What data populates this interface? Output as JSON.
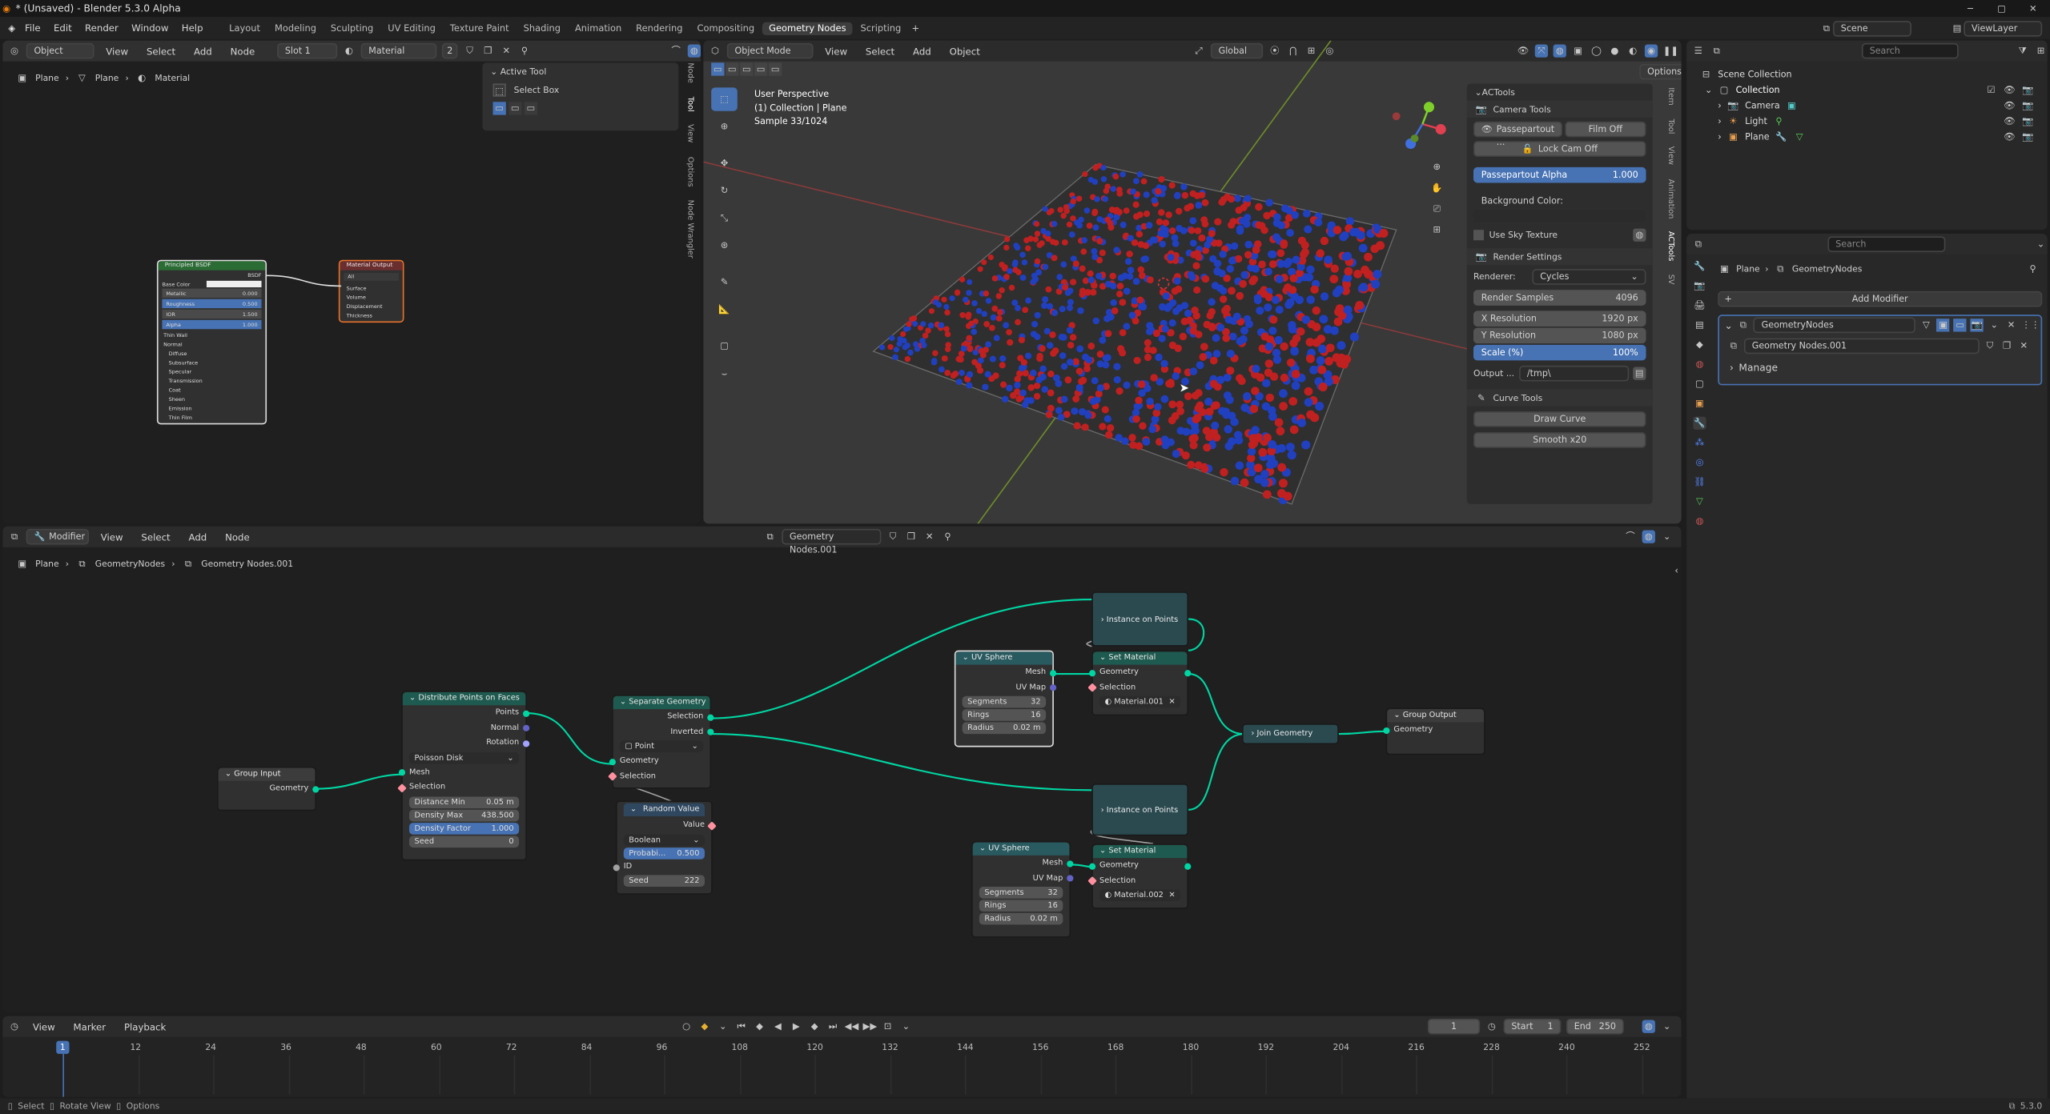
{
  "title": "* (Unsaved) - Blender 5.3.0 Alpha",
  "menu": [
    "File",
    "Edit",
    "Render",
    "Window",
    "Help"
  ],
  "workspaces": [
    "Layout",
    "Modeling",
    "Sculpting",
    "UV Editing",
    "Texture Paint",
    "Shading",
    "Animation",
    "Rendering",
    "Compositing",
    "Geometry Nodes",
    "Scripting"
  ],
  "active_workspace": "Geometry Nodes",
  "shader_editor": {
    "object_dropdown": "Object",
    "menus": [
      "View",
      "Select",
      "Add",
      "Node"
    ],
    "slot": "Slot 1",
    "material": "Material",
    "users": "2",
    "breadcrumb": [
      "Plane",
      "Plane",
      "Material"
    ],
    "active_tool_title": "Active Tool",
    "active_tool": "Select Box",
    "tabs": [
      "Node",
      "Tool",
      "View",
      "Options",
      "Node Wrangler"
    ],
    "bsdf_title": "Principled BSDF",
    "bsdf_label": "BSDF",
    "bsdf_rows": [
      {
        "name": "Base Color",
        "value": ""
      },
      {
        "name": "Metallic",
        "value": "0.000"
      },
      {
        "name": "Roughness",
        "value": "0.500"
      },
      {
        "name": "IOR",
        "value": "1.500"
      },
      {
        "name": "Alpha",
        "value": "1.000"
      }
    ],
    "bsdf_extra": [
      "Thin Wall",
      "Normal",
      "Diffuse",
      "Subsurface",
      "Specular",
      "Transmission",
      "Coat",
      "Sheen",
      "Emission",
      "Thin Film"
    ],
    "mat_out_title": "Material Output",
    "mat_out_target": "All",
    "mat_out_rows": [
      "Surface",
      "Volume",
      "Displacement",
      "Thickness"
    ]
  },
  "viewport": {
    "mode": "Object Mode",
    "menus": [
      "View",
      "Select",
      "Add",
      "Object"
    ],
    "orientation": "Global",
    "options": "Options",
    "overlay_text": [
      "User Perspective",
      "(1) Collection | Plane",
      "Sample 33/1024"
    ],
    "sidebar_tabs": [
      "Item",
      "Tool",
      "View",
      "Animation",
      "ACTools",
      "SV"
    ],
    "actools": {
      "title": "ACTools",
      "camera_tools": "Camera Tools",
      "passepartout": "Passepartout ...",
      "film_off": "Film Off",
      "lock_cam": "Lock Cam Off",
      "pp_alpha_label": "Passepartout Alpha",
      "pp_alpha_value": "1.000",
      "bg_color": "Background Color:",
      "use_sky": "Use Sky Texture",
      "render_settings": "Render Settings",
      "renderer_label": "Renderer:",
      "renderer": "Cycles",
      "samples_label": "Render Samples",
      "samples": "4096",
      "xres_label": "X Resolution",
      "xres": "1920 px",
      "yres_label": "Y Resolution",
      "yres": "1080 px",
      "scale_label": "Scale (%)",
      "scale": "100%",
      "output_label": "Output ...",
      "output_path": "/tmp\\",
      "curve_tools": "Curve Tools",
      "draw_curve": "Draw Curve",
      "smooth": "Smooth x20"
    },
    "gizmo_axes": [
      "X",
      "Y",
      "Z"
    ]
  },
  "outliner": {
    "search_placeholder": "Search",
    "scene": "Scene",
    "view_layer": "ViewLayer",
    "root": "Scene Collection",
    "collection": "Collection",
    "items": [
      "Camera",
      "Light",
      "Plane"
    ]
  },
  "properties": {
    "search_placeholder": "Search",
    "breadcrumb": [
      "Plane",
      "GeometryNodes"
    ],
    "add_modifier": "Add Modifier",
    "modifier_name": "GeometryNodes",
    "node_group": "Geometry Nodes.001",
    "manage": "Manage"
  },
  "geo_editor": {
    "mode": "Modifier",
    "menus": [
      "View",
      "Select",
      "Add",
      "Node"
    ],
    "node_group": "Geometry Nodes.001",
    "breadcrumb": [
      "Plane",
      "GeometryNodes",
      "Geometry Nodes.001"
    ],
    "nodes": {
      "group_input": {
        "title": "Group Input",
        "out": "Geometry"
      },
      "distribute": {
        "title": "Distribute Points on Faces",
        "outs": [
          "Points",
          "Normal",
          "Rotation"
        ],
        "method": "Poisson Disk",
        "ins": [
          "Mesh",
          "Selection"
        ],
        "fields": [
          {
            "name": "Distance Min",
            "value": "0.05 m"
          },
          {
            "name": "Density Max",
            "value": "438.500"
          },
          {
            "name": "Density Factor",
            "value": "1.000"
          },
          {
            "name": "Seed",
            "value": "0"
          }
        ]
      },
      "separate": {
        "title": "Separate Geometry",
        "outs": [
          "Selection",
          "Inverted"
        ],
        "domain": "Point",
        "ins": [
          "Geometry",
          "Selection"
        ]
      },
      "random": {
        "title": "Random Value",
        "out": "Value",
        "type": "Boolean",
        "fields": [
          {
            "name": "Probabi...",
            "value": "0.500"
          },
          {
            "name": "ID",
            "value": ""
          },
          {
            "name": "Seed",
            "value": "222"
          }
        ]
      },
      "uv1": {
        "title": "UV Sphere",
        "outs": [
          "Mesh",
          "UV Map"
        ],
        "fields": [
          {
            "name": "Segments",
            "value": "32"
          },
          {
            "name": "Rings",
            "value": "16"
          },
          {
            "name": "Radius",
            "value": "0.02 m"
          }
        ]
      },
      "uv2": {
        "title": "UV Sphere",
        "outs": [
          "Mesh",
          "UV Map"
        ],
        "fields": [
          {
            "name": "Segments",
            "value": "32"
          },
          {
            "name": "Rings",
            "value": "16"
          },
          {
            "name": "Radius",
            "value": "0.02 m"
          }
        ]
      },
      "iop1": {
        "title": "Instance on Points"
      },
      "iop2": {
        "title": "Instance on Points"
      },
      "setmat1": {
        "title": "Set Material",
        "ins": [
          "Geometry",
          "Selection"
        ],
        "material": "Material.001"
      },
      "setmat2": {
        "title": "Set Material",
        "ins": [
          "Geometry",
          "Selection"
        ],
        "material": "Material.002"
      },
      "join": {
        "title": "Join Geometry"
      },
      "group_output": {
        "title": "Group Output",
        "in": "Geometry"
      }
    }
  },
  "timeline": {
    "menus": [
      "View",
      "Marker",
      "Playback"
    ],
    "current_frame": "1",
    "start_label": "Start",
    "start": "1",
    "end_label": "End",
    "end": "250",
    "ticks": [
      "1",
      "12",
      "24",
      "36",
      "48",
      "60",
      "72",
      "84",
      "96",
      "108",
      "120",
      "132",
      "144",
      "156",
      "168",
      "180",
      "192",
      "204",
      "216",
      "228",
      "240",
      "252"
    ]
  },
  "status_bar": {
    "hints": [
      "Select",
      "Rotate View",
      "Options"
    ],
    "version": "5.3.0"
  }
}
